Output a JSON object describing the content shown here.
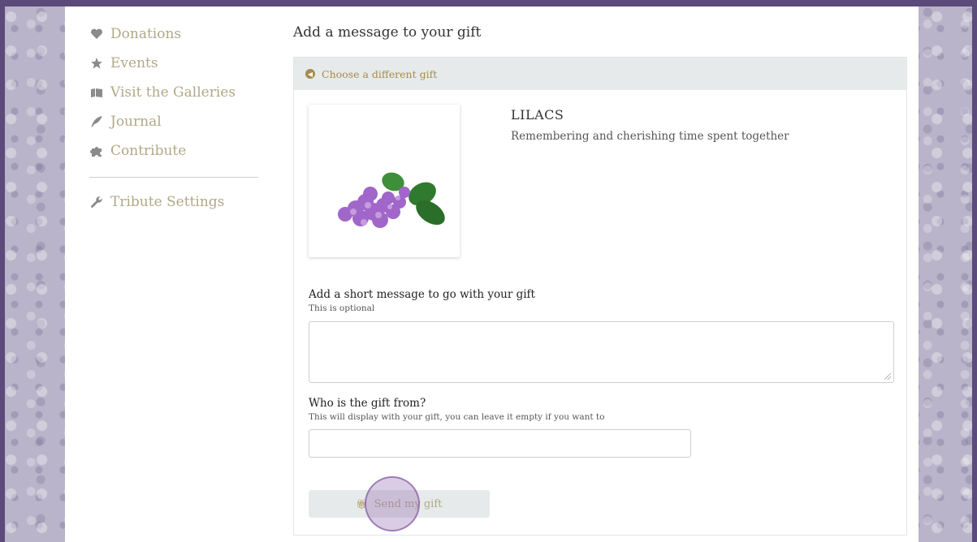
{
  "sidebar": {
    "items": [
      {
        "label": "Donations",
        "icon": "heart-icon"
      },
      {
        "label": "Events",
        "icon": "star-icon"
      },
      {
        "label": "Visit the Galleries",
        "icon": "gallery-icon"
      },
      {
        "label": "Journal",
        "icon": "quill-icon"
      },
      {
        "label": "Contribute",
        "icon": "puzzle-icon"
      }
    ],
    "settings_label": "Tribute Settings"
  },
  "main": {
    "title": "Add a message to your gift",
    "choose_different": "Choose a different gift",
    "gift": {
      "name": "LILACS",
      "description": "Remembering and cherishing time spent together"
    },
    "message": {
      "label": "Add a short message to go with your gift",
      "hint": "This is optional",
      "value": ""
    },
    "from": {
      "label": "Who is the gift from?",
      "hint": "This will display with your gift, you can leave it empty if you want to",
      "value": ""
    },
    "send_label": "Send my gift"
  },
  "colors": {
    "accent": "#a48c4a",
    "sidebar_text": "#b0a886",
    "panel_header_bg": "#e7eaea",
    "frame_border": "#5b4a7a"
  }
}
